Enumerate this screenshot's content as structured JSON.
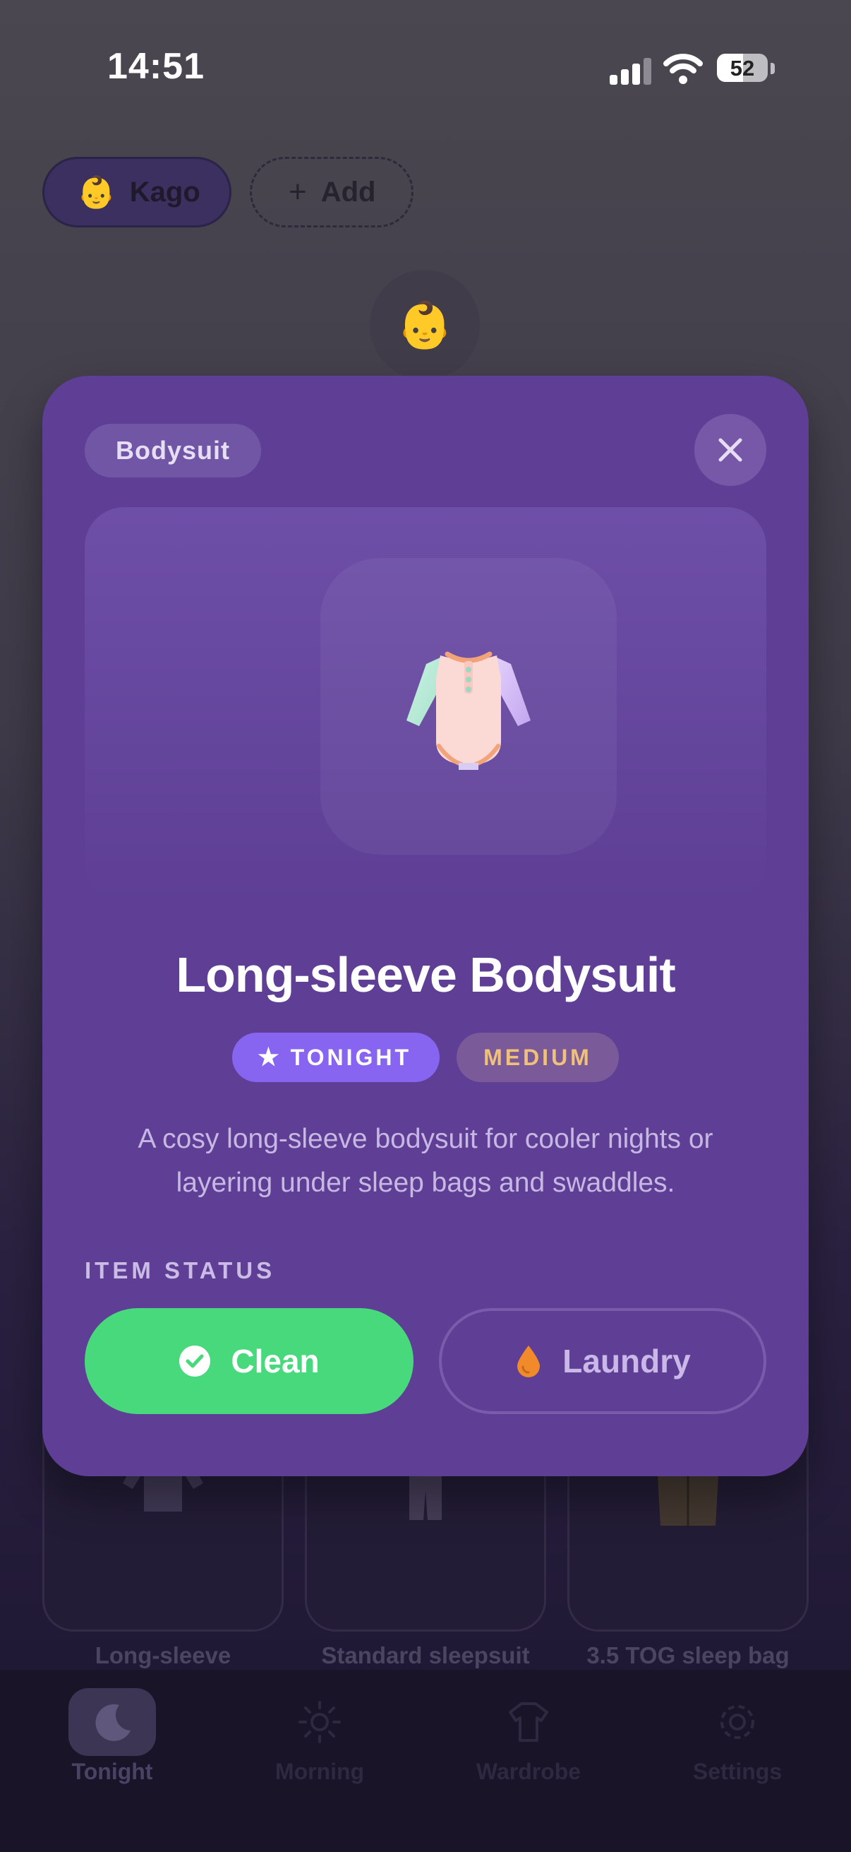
{
  "status_bar": {
    "time": "14:51",
    "battery": "52",
    "battery_level": 0.52
  },
  "profiles": {
    "active": {
      "emoji": "👶",
      "name": "Kago"
    },
    "add": {
      "plus": "+",
      "label": "Add"
    },
    "center_avatar": "👶"
  },
  "background_cards": [
    {
      "label": "Long-sleeve"
    },
    {
      "label": "Standard sleepsuit"
    },
    {
      "label": "3.5 TOG sleep bag"
    }
  ],
  "tabs": [
    {
      "label": "Tonight",
      "icon": "moon-icon",
      "active": true
    },
    {
      "label": "Morning",
      "icon": "sun-icon",
      "active": false
    },
    {
      "label": "Wardrobe",
      "icon": "shirt-icon",
      "active": false
    },
    {
      "label": "Settings",
      "icon": "gear-icon",
      "active": false
    }
  ],
  "modal": {
    "category": "Bodysuit",
    "close_icon": "close-icon",
    "item_icon": "bodysuit-icon",
    "title": "Long-sleeve Bodysuit",
    "badges": {
      "tonight_star": "★",
      "tonight": "TONIGHT",
      "warmth": "MEDIUM"
    },
    "description": "A cosy long-sleeve bodysuit for cooler nights or layering under sleep bags and swaddles.",
    "status_label": "ITEM STATUS",
    "clean_button": {
      "label": "Clean",
      "icon": "check-circle-icon",
      "selected": true
    },
    "laundry_button": {
      "label": "Laundry",
      "icon": "water-drop-icon",
      "selected": false
    }
  },
  "colors": {
    "modal_bg": "#5e3f95",
    "accent_purple": "#8865f0",
    "clean_green": "#47d97b",
    "medium_amber": "#f0c178",
    "drop_orange": "#f08a2a"
  }
}
